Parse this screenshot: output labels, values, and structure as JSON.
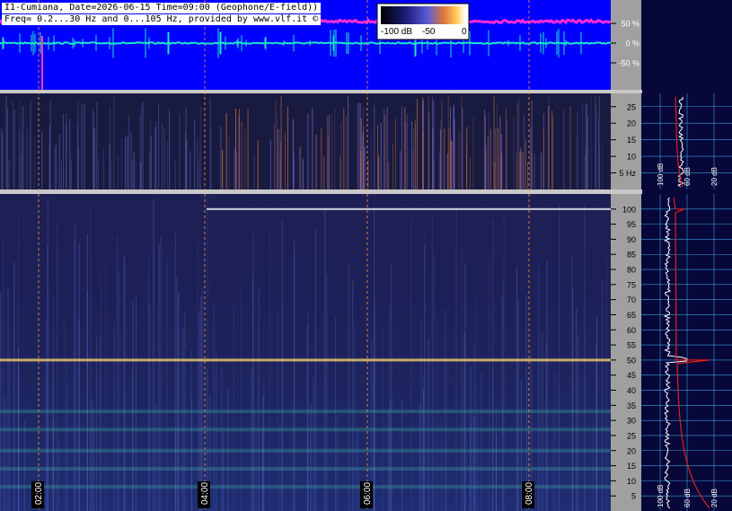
{
  "header": {
    "line1": "I1-Cumiana, Date=2026-06-15 Time=09:00 (Geophone/E-field))",
    "line2": "Freq= 0.2...30 Hz and 0...105 Hz, provided by www.vlf.it ©"
  },
  "colorbar": {
    "label_low": "-100 dB",
    "label_mid": "-50",
    "label_high": "0"
  },
  "colors": {
    "panel_bg": "#0000ff",
    "axis_gray": "#a0a0a0",
    "profile_bg": "#07073a",
    "trace_magenta": "#ff2bd6",
    "trace_cyan": "#1fe6c8",
    "gridline_orange": "#ff9a3c",
    "red_curve": "#e0201a"
  },
  "chart_data": [
    {
      "type": "line",
      "name": "waveform",
      "ylabel": "%",
      "ylim": [
        -100,
        100
      ],
      "yticks": [
        50,
        0,
        -50
      ],
      "ytick_labels": [
        "50 %",
        "0 %",
        "-50 %"
      ],
      "series": [
        {
          "name": "magenta",
          "level": 55,
          "color": "#ff2bd6"
        },
        {
          "name": "cyan",
          "level": 0,
          "color": "#1fe6c8"
        }
      ]
    },
    {
      "type": "heatmap",
      "name": "low-frequency spectrogram",
      "ylim": [
        0,
        29
      ],
      "yticks": [
        5,
        10,
        15,
        20,
        25
      ],
      "ytick_labels": [
        "5 Hz",
        "10",
        "15",
        "20",
        "25"
      ],
      "profile_xticks": [
        "100 dB",
        "60 dB",
        "20 dB"
      ]
    },
    {
      "type": "heatmap",
      "name": "ELF spectrogram",
      "ylim": [
        0,
        105
      ],
      "yticks": [
        5,
        10,
        15,
        20,
        25,
        30,
        35,
        40,
        45,
        50,
        55,
        60,
        65,
        70,
        75,
        80,
        85,
        90,
        95,
        100
      ],
      "ytick_labels": [
        "5",
        "10",
        "15",
        "20",
        "25",
        "30",
        "35",
        "40",
        "45",
        "50",
        "55",
        "60",
        "65",
        "70",
        "75",
        "80",
        "85",
        "90",
        "95",
        "100"
      ],
      "xticks": [
        "02:00",
        "04:00",
        "06:00",
        "08:00"
      ],
      "profile_xticks": [
        "100 dB",
        "60 dB",
        "20 dB"
      ]
    }
  ]
}
